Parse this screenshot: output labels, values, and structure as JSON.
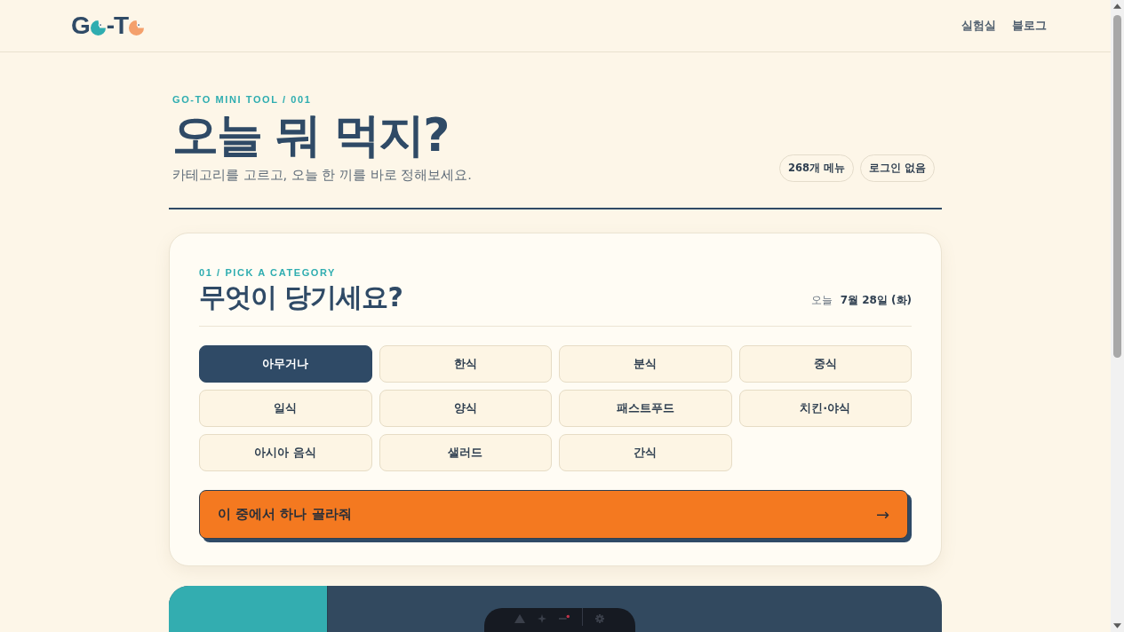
{
  "header": {
    "logo": [
      {
        "kind": "letter",
        "text": "G"
      },
      {
        "kind": "ball",
        "color": "#2fadb0"
      },
      {
        "kind": "letter",
        "text": "-T"
      },
      {
        "kind": "ball",
        "color": "#f4a06c"
      }
    ],
    "nav": [
      {
        "label": "실험실"
      },
      {
        "label": "블로그"
      }
    ]
  },
  "hero": {
    "eyebrow": "GO-TO MINI TOOL / 001",
    "title": "오늘 뭐 먹지?",
    "subtitle": "카테고리를 고르고, 오늘 한 끼를 바로 정해보세요.",
    "badges": [
      "268개 메뉴",
      "로그인 없음"
    ]
  },
  "picker": {
    "eyebrow": "01 / PICK A CATEGORY",
    "title": "무엇이 당기세요?",
    "date_label": "오늘",
    "date": "7월 28일 (화)",
    "categories": [
      {
        "label": "아무거나",
        "selected": true
      },
      {
        "label": "한식",
        "selected": false
      },
      {
        "label": "분식",
        "selected": false
      },
      {
        "label": "중식",
        "selected": false
      },
      {
        "label": "일식",
        "selected": false
      },
      {
        "label": "양식",
        "selected": false
      },
      {
        "label": "패스트푸드",
        "selected": false
      },
      {
        "label": "치킨·야식",
        "selected": false
      },
      {
        "label": "아시아 음식",
        "selected": false
      },
      {
        "label": "샐러드",
        "selected": false
      },
      {
        "label": "간식",
        "selected": false
      }
    ],
    "action": {
      "label": "이 중에서 하나 골라줘",
      "arrow": "→"
    }
  }
}
